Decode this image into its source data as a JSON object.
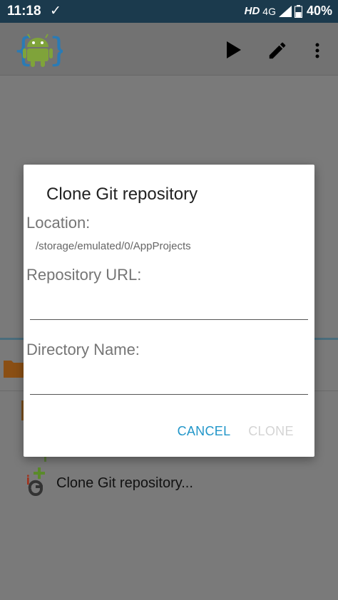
{
  "status_bar": {
    "time": "11:18",
    "hd": "HD",
    "network": "4G",
    "battery": "40%"
  },
  "icons": {
    "check": "check-icon",
    "signal": "signal-icon",
    "battery": "battery-icon",
    "logo": "android-logo-icon",
    "play": "play-icon",
    "edit": "pencil-icon",
    "more": "more-vert-icon",
    "folder": "folder-icon",
    "git": "git-icon"
  },
  "background_list": {
    "git_item_label": "Clone Git repository..."
  },
  "dialog": {
    "title": "Clone Git repository",
    "location_label": "Location:",
    "location_value": "/storage/emulated/0/AppProjects",
    "repo_url_label": "Repository URL:",
    "repo_url_value": "",
    "directory_label": "Directory Name:",
    "directory_value": "",
    "cancel_label": "CANCEL",
    "clone_label": "CLONE"
  },
  "colors": {
    "status_bar": "#1b3a4d",
    "accent": "#2196c9",
    "disabled": "#d4d4d4",
    "scrim_background": "#7a7a7a"
  }
}
